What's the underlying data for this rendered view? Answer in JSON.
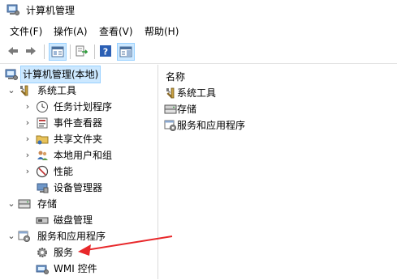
{
  "window": {
    "title": "计算机管理"
  },
  "menu": {
    "file": "文件(F)",
    "action": "操作(A)",
    "view": "查看(V)",
    "help": "帮助(H)"
  },
  "toolbar": {
    "back": "back-icon",
    "forward": "forward-icon",
    "show_tree": "console-tree-icon",
    "export": "export-list-icon",
    "help": "help-icon",
    "details": "details-pane-icon"
  },
  "tree": {
    "root": "计算机管理(本地)",
    "system_tools": "系统工具",
    "task_scheduler": "任务计划程序",
    "event_viewer": "事件查看器",
    "shared_folders": "共享文件夹",
    "local_users": "本地用户和组",
    "performance": "性能",
    "device_manager": "设备管理器",
    "storage": "存储",
    "disk_management": "磁盘管理",
    "services_apps": "服务和应用程序",
    "services": "服务",
    "wmi": "WMI 控件"
  },
  "list": {
    "header": "名称",
    "items": [
      "系统工具",
      "存储",
      "服务和应用程序"
    ]
  },
  "colors": {
    "selection": "#cce8ff",
    "arrow": "#e8282b"
  }
}
